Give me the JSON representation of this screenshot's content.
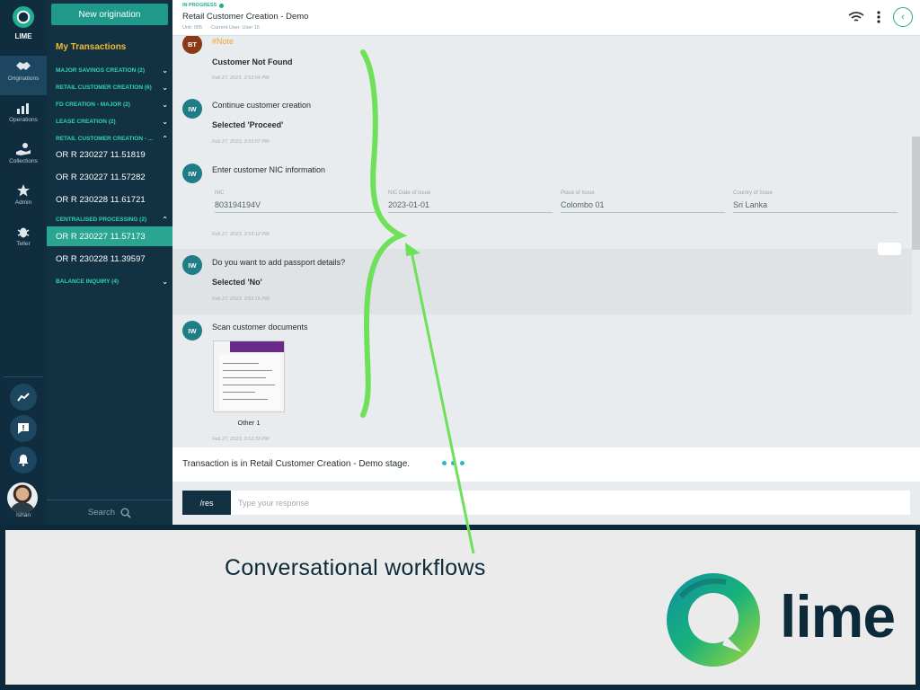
{
  "rail": {
    "logo_text": "LIME",
    "items": [
      {
        "label": "Originations",
        "icon": "handshake-icon"
      },
      {
        "label": "Operations",
        "icon": "bar-chart-icon"
      },
      {
        "label": "Collections",
        "icon": "money-hand-icon"
      },
      {
        "label": "Admin",
        "icon": "star-icon"
      },
      {
        "label": "Teller",
        "icon": "bug-icon"
      }
    ],
    "user_name": "Ishan"
  },
  "sidebar": {
    "new_button": "New origination",
    "title": "My Transactions",
    "groups": [
      "MAJOR SAVINGS CREATION (2)",
      "RETAIL CUSTOMER CREATION (6)",
      "FD CREATION - MAJOR (2)",
      "LEASE CREATION (2)",
      "RETAIL CUSTOMER CREATION - ...",
      "CENTRALISED PROCESSING (2)",
      "BALANCE INQUIRY (4)"
    ],
    "transactions": [
      "OR R 230227 11.51819",
      "OR R 230227 11.57282",
      "OR R 230228 11.61721",
      "OR R 230227 11.57173",
      "OR R 230228 11.39597"
    ],
    "search_label": "Search"
  },
  "header": {
    "status": "IN PROGRESS",
    "title": "Retail Customer Creation - Demo",
    "unit": "Unit: 005",
    "current_user": "Current User: User 16"
  },
  "messages": {
    "m0": {
      "avatar": "BT",
      "note": "#Note",
      "body": "Customer Not Found",
      "time": "Feb 27, 2023, 3:53:04 PM"
    },
    "m1": {
      "avatar": "IW",
      "title": "Continue customer creation",
      "body": "Selected 'Proceed'",
      "time": "Feb 27, 2023, 3:53:07 PM"
    },
    "m2": {
      "avatar": "IW",
      "title": "Enter customer NIC information",
      "fields": [
        {
          "label": "NIC",
          "value": "803194194V"
        },
        {
          "label": "NIC Date of Issue",
          "value": "2023-01-01"
        },
        {
          "label": "Place of Issue",
          "value": "Colombo 01"
        },
        {
          "label": "Country of Issue",
          "value": "Sri Lanka"
        }
      ],
      "time": "Feb 27, 2023, 3:53:12 PM"
    },
    "m3": {
      "avatar": "IW",
      "title": "Do you want to add passport details?",
      "body": "Selected 'No'",
      "time": "Feb 27, 2023, 3:53:15 PM"
    },
    "m4": {
      "avatar": "IW",
      "title": "Scan customer documents",
      "doc_caption": "Other 1",
      "time": "Feb 27, 2023, 3:53:33 PM"
    }
  },
  "stage": {
    "text": "Transaction is in Retail Customer Creation - Demo stage."
  },
  "composer": {
    "command": "/res",
    "placeholder": "Type your response"
  },
  "banner": {
    "tagline": "Conversational workflows",
    "brand": "lime"
  },
  "colors": {
    "accent": "#1fae8f",
    "dark": "#0d2a3a",
    "note": "#f5a623",
    "annotation": "#6ee05a"
  }
}
